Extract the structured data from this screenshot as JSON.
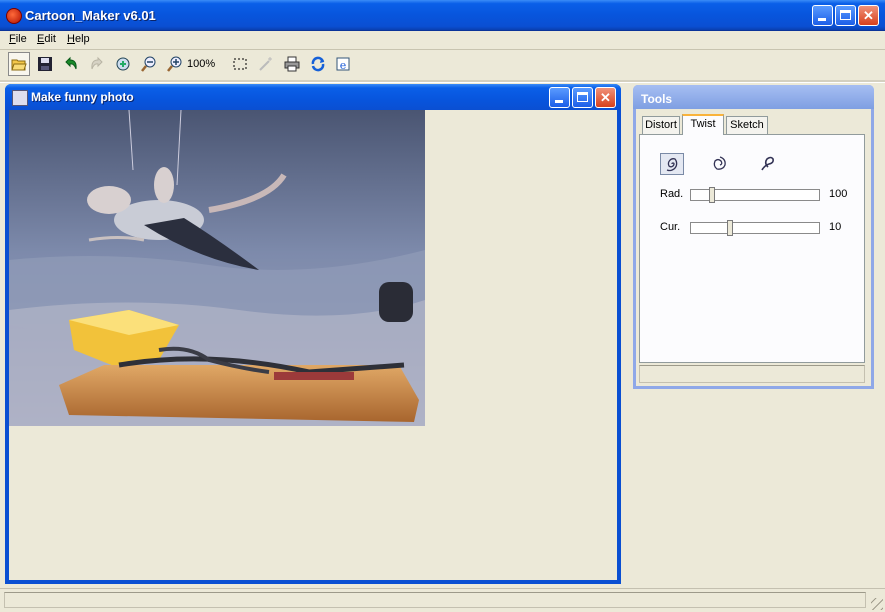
{
  "app": {
    "title": "Cartoon_Maker v6.01"
  },
  "menu": [
    {
      "label": "File",
      "mnemonic": "F"
    },
    {
      "label": "Edit",
      "mnemonic": "E"
    },
    {
      "label": "Help",
      "mnemonic": "H"
    }
  ],
  "toolbar": {
    "zoom": "100%",
    "icons": [
      "open-folder-icon",
      "save-icon",
      "undo-icon",
      "redo-icon",
      "fit-icon",
      "zoom-out-icon",
      "zoom-in-icon",
      "select-rect-icon",
      "magic-wand-icon",
      "print-icon",
      "refresh-icon",
      "browser-icon"
    ]
  },
  "document": {
    "title": "Make funny photo"
  },
  "tools": {
    "title": "Tools",
    "tabs": [
      "Distort",
      "Twist",
      "Sketch"
    ],
    "active_tab": "Twist",
    "sliders": [
      {
        "label": "Rad.",
        "value": "100",
        "fraction": 0.15
      },
      {
        "label": "Cur.",
        "value": "10",
        "fraction": 0.3
      }
    ]
  },
  "colors": {
    "title_blue": "#0a5fe8",
    "close_red": "#d8401c",
    "face": "#ece9d8",
    "tools_caption": "#8fa8e8"
  }
}
